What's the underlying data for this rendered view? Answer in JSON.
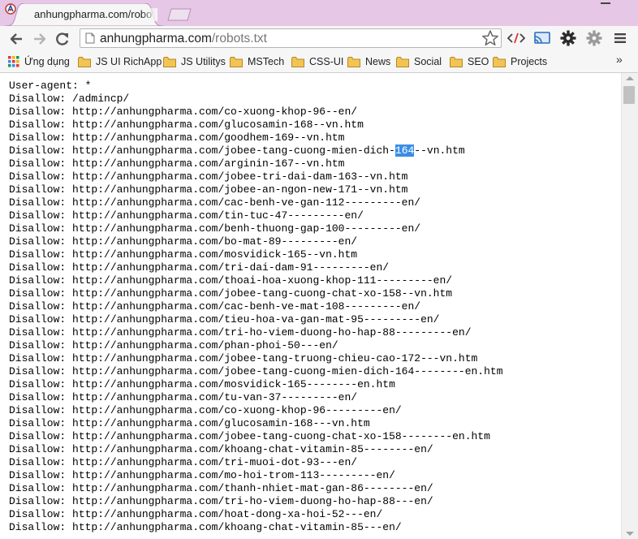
{
  "browser": {
    "tab_title": "anhungpharma.com/robots.txt",
    "url_host": "anhungpharma.com",
    "url_path": "/robots.txt"
  },
  "toolbar": {
    "icons": [
      "back-icon",
      "forward-icon",
      "reload-icon",
      "star-icon",
      "source-code-icon",
      "cast-icon",
      "gear-icon",
      "extension-gear-icon",
      "menu-icon"
    ]
  },
  "bookmarks": {
    "apps": "Ứng dụng",
    "items": [
      "JS UI RichApp",
      "JS Utilitys",
      "MSTech",
      "CSS-UI",
      "News",
      "Social",
      "SEO",
      "Projects"
    ],
    "more": "»"
  },
  "document": {
    "user_agent": "User-agent: *",
    "lines": [
      "Disallow: /admincp/",
      "Disallow: http://anhungpharma.com/co-xuong-khop-96--en/",
      "Disallow: http://anhungpharma.com/glucosamin-168--vn.htm",
      "Disallow: http://anhungpharma.com/goodhem-169--vn.htm",
      "Disallow: http://anhungpharma.com/jobee-tang-cuong-mien-dich-164--vn.htm",
      "Disallow: http://anhungpharma.com/arginin-167--vn.htm",
      "Disallow: http://anhungpharma.com/jobee-tri-dai-dam-163--vn.htm",
      "Disallow: http://anhungpharma.com/jobee-an-ngon-new-171--vn.htm",
      "Disallow: http://anhungpharma.com/cac-benh-ve-gan-112---------en/",
      "Disallow: http://anhungpharma.com/tin-tuc-47---------en/",
      "Disallow: http://anhungpharma.com/benh-thuong-gap-100---------en/",
      "Disallow: http://anhungpharma.com/bo-mat-89---------en/",
      "Disallow: http://anhungpharma.com/mosvidick-165--vn.htm",
      "Disallow: http://anhungpharma.com/tri-dai-dam-91---------en/",
      "Disallow: http://anhungpharma.com/thoai-hoa-xuong-khop-111---------en/",
      "Disallow: http://anhungpharma.com/jobee-tang-cuong-chat-xo-158--vn.htm",
      "Disallow: http://anhungpharma.com/cac-benh-ve-mat-108---------en/",
      "Disallow: http://anhungpharma.com/tieu-hoa-va-gan-mat-95---------en/",
      "Disallow: http://anhungpharma.com/tri-ho-viem-duong-ho-hap-88---------en/",
      "Disallow: http://anhungpharma.com/phan-phoi-50---en/",
      "Disallow: http://anhungpharma.com/jobee-tang-truong-chieu-cao-172---vn.htm",
      "Disallow: http://anhungpharma.com/jobee-tang-cuong-mien-dich-164--------en.htm",
      "Disallow: http://anhungpharma.com/mosvidick-165--------en.htm",
      "Disallow: http://anhungpharma.com/tu-van-37---------en/",
      "Disallow: http://anhungpharma.com/co-xuong-khop-96---------en/",
      "Disallow: http://anhungpharma.com/glucosamin-168---vn.htm",
      "Disallow: http://anhungpharma.com/jobee-tang-cuong-chat-xo-158--------en.htm",
      "Disallow: http://anhungpharma.com/khoang-chat-vitamin-85--------en/",
      "Disallow: http://anhungpharma.com/tri-muoi-dot-93---en/",
      "Disallow: http://anhungpharma.com/mo-hoi-trom-113---------en/",
      "Disallow: http://anhungpharma.com/thanh-nhiet-mat-gan-86--------en/",
      "Disallow: http://anhungpharma.com/tri-ho-viem-duong-ho-hap-88---en/",
      "Disallow: http://anhungpharma.com/hoat-dong-xa-hoi-52---en/",
      "Disallow: http://anhungpharma.com/khoang-chat-vitamin-85---en/"
    ],
    "highlight": {
      "pre": "Disallow: http://anhungpharma.com/jobee-tang-cuong-mien-dich-",
      "selected": "164",
      "post": "--vn.htm"
    }
  },
  "colors": {
    "frame": "#e6c7e6",
    "toolbar": "#f6f6f6",
    "selection": "#3a8ee6",
    "folder": "#e8b74a"
  }
}
